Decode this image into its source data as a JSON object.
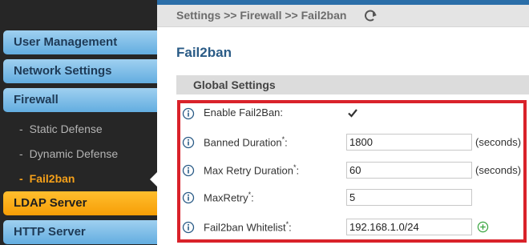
{
  "sidebar": {
    "user_management": "User Management",
    "network_settings": "Network Settings",
    "firewall": "Firewall",
    "firewall_items": [
      {
        "label": "Static Defense"
      },
      {
        "label": "Dynamic Defense"
      },
      {
        "label": "Fail2ban"
      }
    ],
    "ldap_server": "LDAP Server",
    "http_server": "HTTP Server"
  },
  "breadcrumb": "Settings >> Firewall >> Fail2ban",
  "page_title": "Fail2ban",
  "section_title": "Global Settings",
  "fields": {
    "enable": {
      "label": "Enable Fail2Ban:",
      "checked": true
    },
    "banned_duration": {
      "label": "Banned Duration",
      "value": "1800",
      "unit": "(seconds)"
    },
    "max_retry_duration": {
      "label": "Max Retry Duration",
      "value": "60",
      "unit": "(seconds)"
    },
    "max_retry": {
      "label": "MaxRetry",
      "value": "5"
    },
    "whitelist": {
      "label": "Fail2ban Whitelist",
      "value": "192.168.1.0/24"
    }
  },
  "required_marker": "*",
  "colon": ":",
  "dash": "-",
  "icons": {
    "info": "info-icon",
    "refresh": "refresh-icon",
    "check": "checkmark-icon",
    "add": "add-circle-icon"
  },
  "colors": {
    "highlight": "#d9222a",
    "sidebar_button": "#63ade0",
    "active_button": "#f79e06",
    "active_text": "#f5a01a",
    "title": "#2a5b86"
  }
}
